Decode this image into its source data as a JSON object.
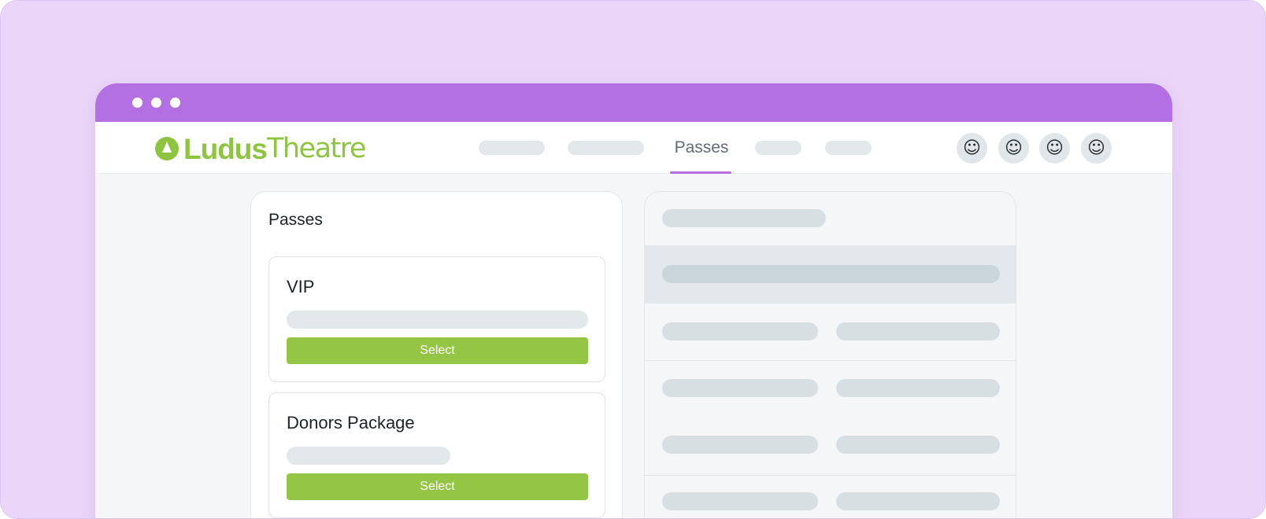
{
  "brand": {
    "name_bold": "Ludus",
    "name_light": "Theatre",
    "color": "#8dc540"
  },
  "nav": {
    "active_label": "Passes",
    "accent": "#b270e2"
  },
  "avatars": [
    "☺",
    "☺",
    "☺",
    "☺"
  ],
  "passes_panel": {
    "title": "Passes",
    "cards": [
      {
        "name": "VIP",
        "button_label": "Select"
      },
      {
        "name": "Donors Package",
        "button_label": "Select"
      }
    ]
  },
  "colors": {
    "background": "#ead6f8",
    "titlebar": "#b270e2",
    "button": "#94c545",
    "skeleton": "#e2e7ea"
  }
}
